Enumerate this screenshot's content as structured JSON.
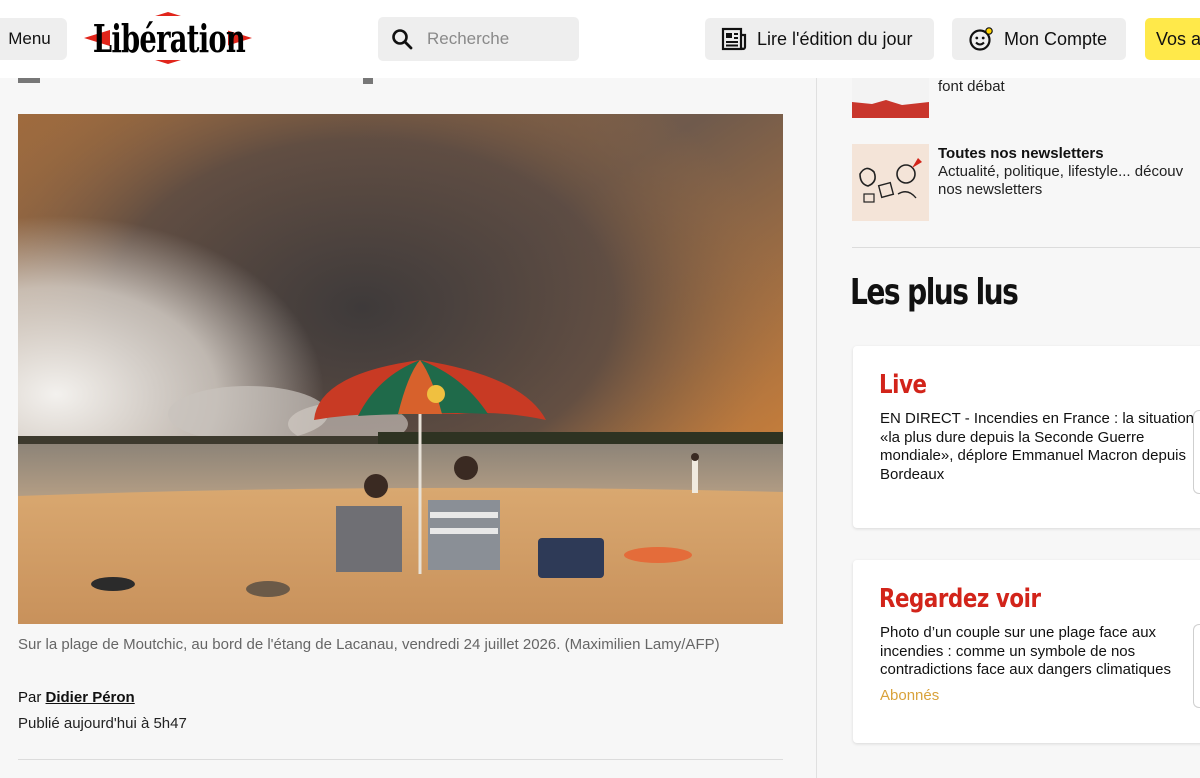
{
  "header": {
    "menu_label": "Menu",
    "logo_text": "Libération",
    "search_placeholder": "Recherche",
    "edition_label": "Lire l'édition du jour",
    "account_label": "Mon Compte",
    "subscribe_label": "Vos a"
  },
  "article": {
    "caption": "Sur la plage de Moutchic, au bord de l'étang de Lacanau, vendredi 24 juillet 2026. (Maximilien Lamy/AFP)",
    "byline_prefix": "Par ",
    "author": "Didier Péron",
    "published": "Publié aujourd'hui à 5h47"
  },
  "sidebar": {
    "newsletter_item_1_text": "font débat",
    "newsletter_item_2_title": "Toutes nos newsletters",
    "newsletter_item_2_desc": "Actualité, politique, lifestyle... découv nos newsletters",
    "section_title": "Les plus lus",
    "cards": [
      {
        "label": "Live",
        "text": "EN DIRECT - Incendies en France : la situation «la plus dure depuis la Seconde Guerre mondiale», déplore Emmanuel Macron depuis Bordeaux",
        "tag": ""
      },
      {
        "label": "Regardez voir",
        "text": "Photo d’un couple sur une plage face aux incendies : comme un symbole de nos contradictions face aux dangers climatiques",
        "tag": "Abonnés"
      }
    ]
  },
  "colors": {
    "brand_red": "#d2241a",
    "subscribe_yellow": "#ffe94a",
    "abonnes_gold": "#d9a23b"
  }
}
